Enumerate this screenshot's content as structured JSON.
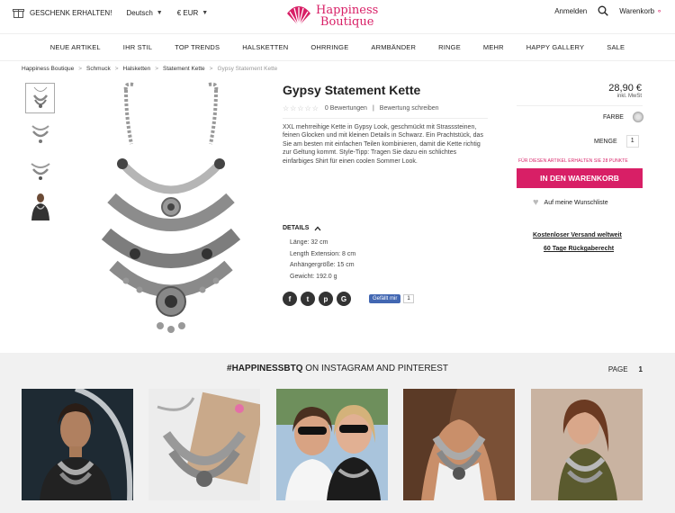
{
  "topbar": {
    "gift_label": "GESCHENK ERHALTEN!",
    "language": "Deutsch",
    "currency": "€ EUR",
    "logo_line1": "Happiness",
    "logo_line2": "Boutique",
    "login": "Anmelden",
    "cart": "Warenkorb"
  },
  "nav": [
    "NEUE ARTIKEL",
    "IHR STIL",
    "TOP TRENDS",
    "HALSKETTEN",
    "OHRRINGE",
    "ARMBÄNDER",
    "RINGE",
    "MEHR",
    "HAPPY GALLERY",
    "SALE"
  ],
  "breadcrumb": [
    "Happiness Boutique",
    "Schmuck",
    "Halsketten",
    "Statement Kette",
    "Gypsy Statement Kette"
  ],
  "product": {
    "title": "Gypsy Statement Kette",
    "reviews": "0 Bewertungen",
    "write_review": "Bewertung schreiben",
    "description": "XXL mehrreihige Kette in Gypsy Look, geschmückt mit Strasssteinen, feinen Glocken und mit kleinen Details in Schwarz. Ein Prachtstück, das Sie am besten mit einfachen Teilen kombinieren, damit die Kette richtig zur Geltung kommt. Style-Tipp: Tragen Sie dazu ein schlichtes einfarbiges Shirt für einen coolen Sommer Look.",
    "details_label": "DETAILS",
    "details": [
      "Länge: 32 cm",
      "Length Extension: 8 cm",
      "Anhängergröße: 15 cm",
      "Gewicht: 192.0 g"
    ],
    "fb_like": "Gefällt mir",
    "fb_count": "1"
  },
  "buy": {
    "price": "28,90 €",
    "vat": "inkl. MwSt",
    "color_label": "FARBE",
    "qty_label": "MENGE",
    "qty_value": "1",
    "points": "FÜR DIESEN ARTIKEL ERHALTEN SIE 28 PUNKTE",
    "cart_button": "IN DEN WARENKORB",
    "wishlist": "Auf meine Wunschliste",
    "shipping": "Kostenloser Versand weltweit",
    "returns": "60 Tage Rückgaberecht"
  },
  "instagram": {
    "hashtag": "#HAPPINESSBTQ",
    "heading_rest": " ON INSTAGRAM AND PINTEREST",
    "page_label": "PAGE",
    "page_number": "1"
  },
  "colors": {
    "brand": "#d81f66"
  }
}
